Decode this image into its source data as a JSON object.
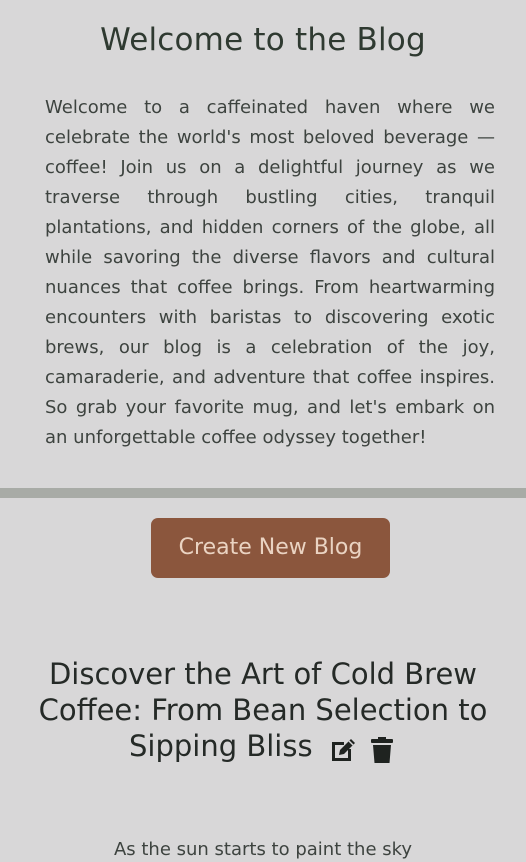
{
  "welcome": {
    "title": "Welcome to the Blog",
    "text": "Welcome to a caffeinated haven where we celebrate the world's most beloved beverage — coffee! Join us on a delightful journey as we traverse through bustling cities, tranquil plantations, and hidden corners of the globe, all while savoring the diverse flavors and cultural nuances that coffee brings. From heartwarming encounters with baristas to discovering exotic brews, our blog is a celebration of the joy, camaraderie, and adventure that coffee inspires. So grab your favorite mug, and let's embark on an unforgettable coffee odyssey together!"
  },
  "actions": {
    "create_label": "Create New Blog"
  },
  "posts": [
    {
      "title": "Discover the Art of Cold Brew Coffee: From Bean Selection to Sipping Bliss",
      "excerpt": "As the sun starts to paint the sky",
      "edit_icon": "edit-icon",
      "delete_icon": "trash-icon"
    }
  ],
  "colors": {
    "background": "#d8d7d8",
    "accent": "#8b563d",
    "divider": "#a8aba6",
    "text": "#2f3431"
  }
}
